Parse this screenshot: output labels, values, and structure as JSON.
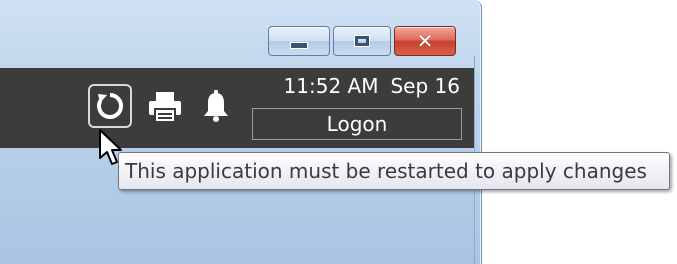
{
  "window": {
    "controls": {
      "minimize_icon": "minimize-icon",
      "maximize_icon": "maximize-icon",
      "close_icon": "close-icon",
      "close_glyph": "✕",
      "close_color": "#c8412e"
    }
  },
  "toolbar": {
    "background": "#3c3c3c",
    "restart_icon": "restart-icon",
    "printer_icon": "printer-icon",
    "bell_icon": "bell-icon",
    "time": "11:52 AM",
    "date": "Sep 16",
    "logon_label": "Logon"
  },
  "tooltip": {
    "text": "This application must be restarted to apply changes"
  }
}
